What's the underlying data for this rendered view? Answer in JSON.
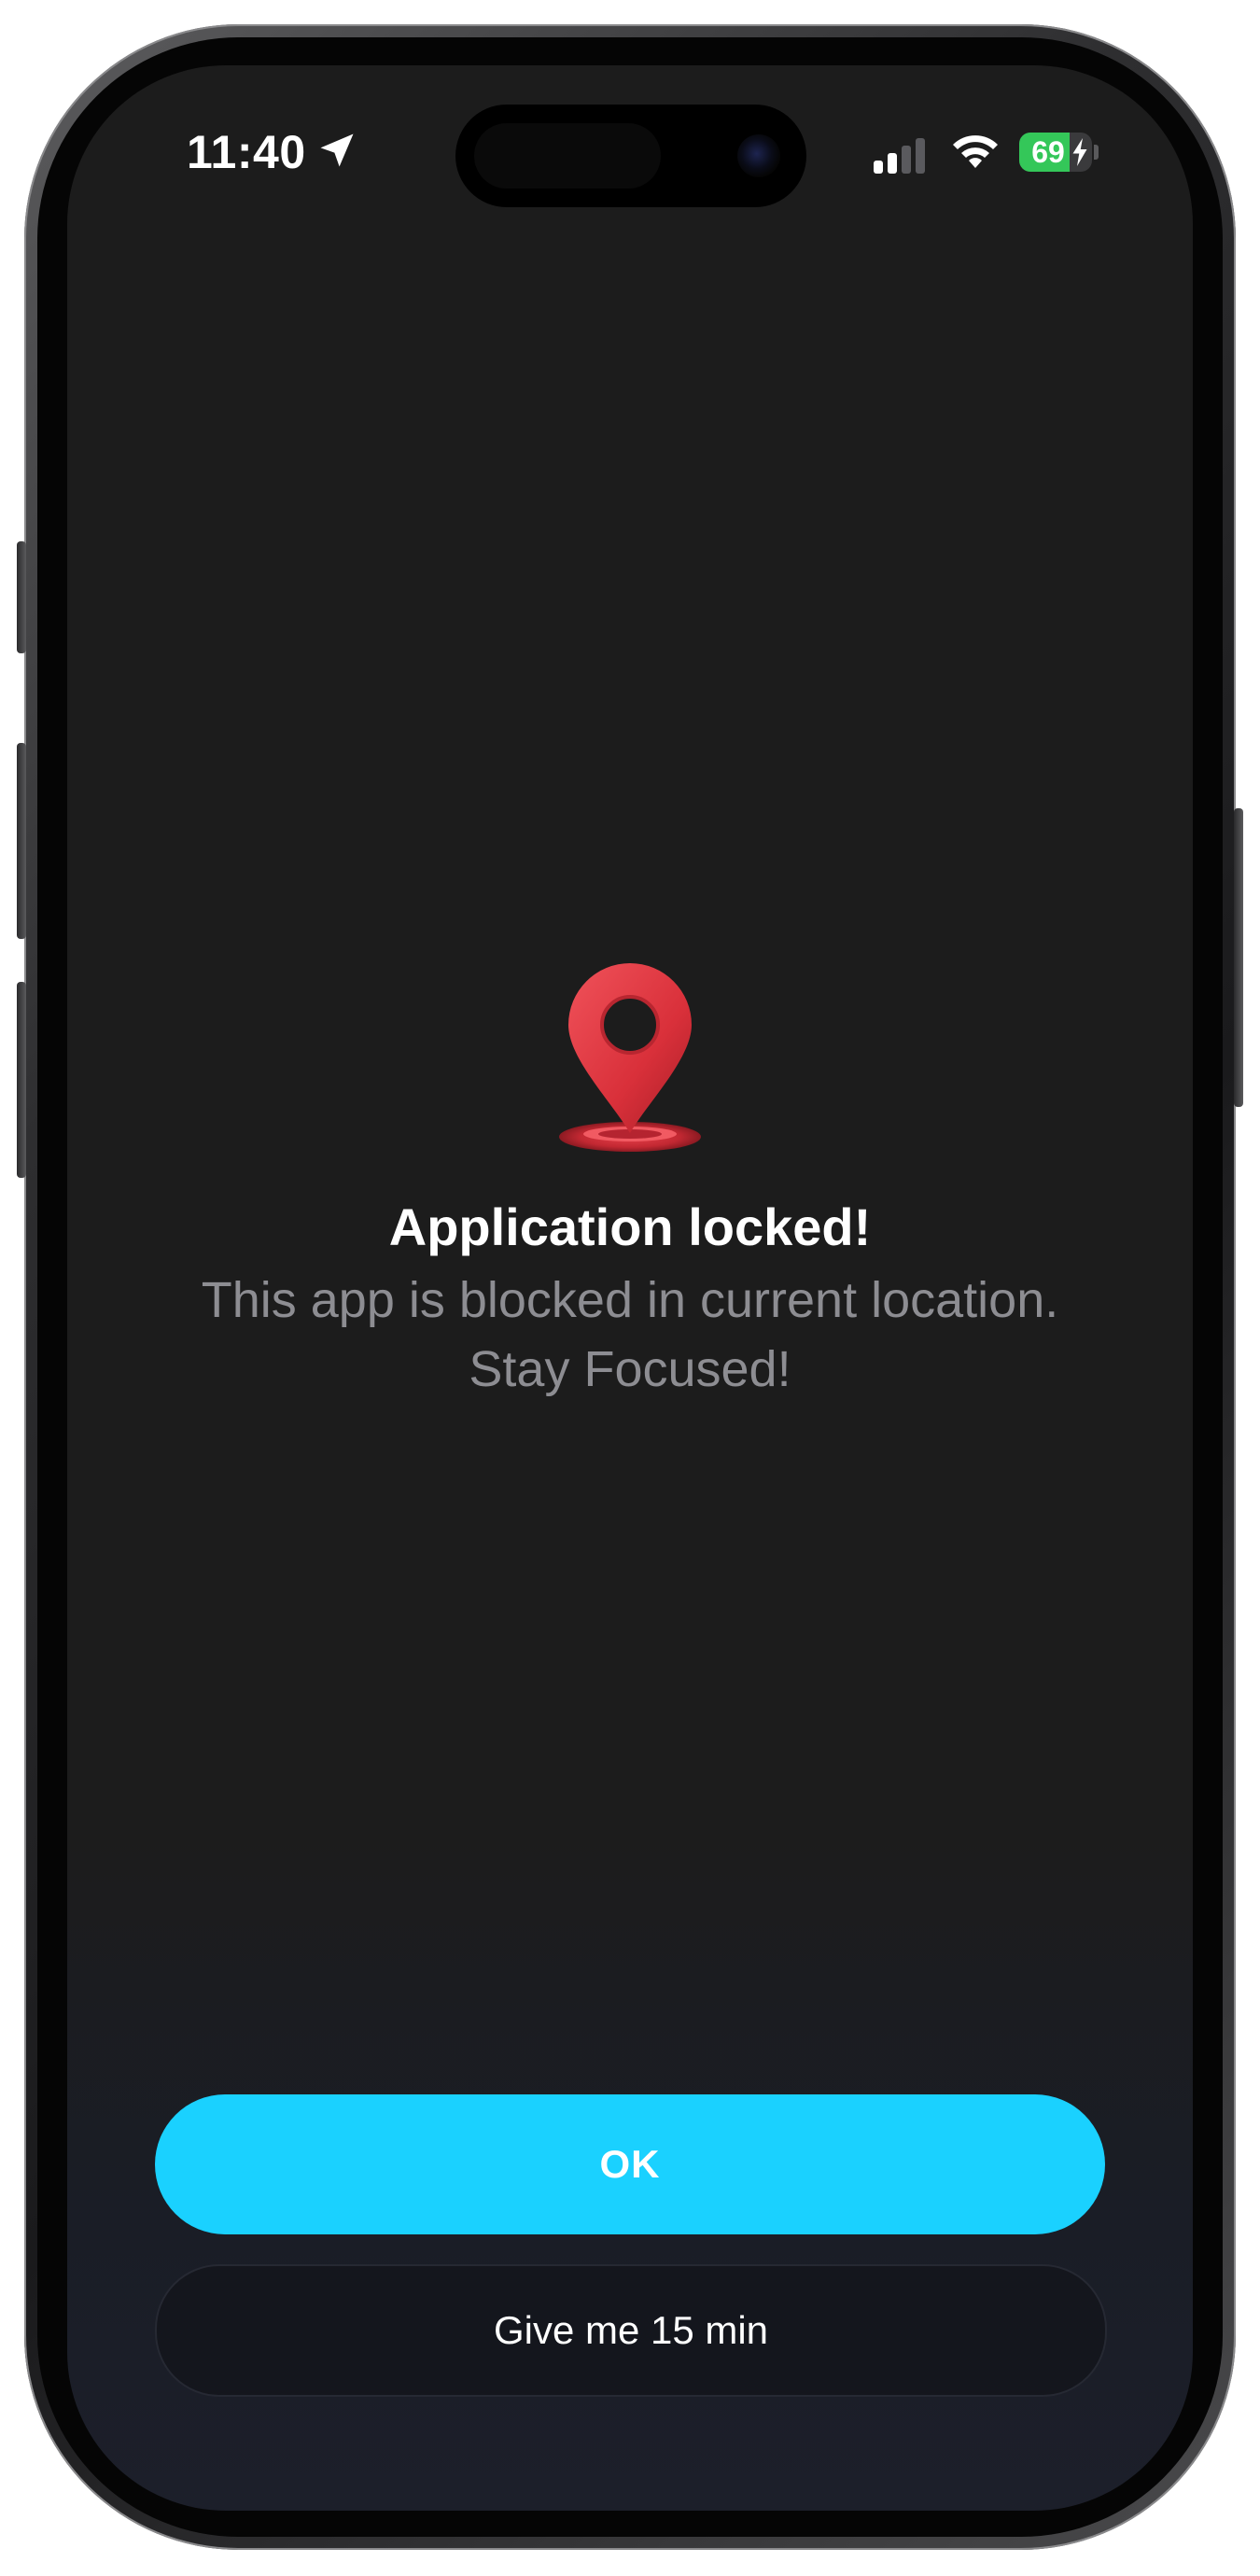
{
  "status_bar": {
    "time": "11:40",
    "battery_level": "69",
    "battery_charging": true,
    "location_active": true,
    "signal_bars_active": 2,
    "signal_bars_total": 4,
    "icons": [
      "location-arrow-icon",
      "cellular-signal-icon",
      "wifi-icon",
      "battery-icon",
      "charging-bolt-icon"
    ]
  },
  "lock_screen": {
    "icon": "map-pin-icon",
    "title": "Application locked!",
    "message_line1": "This app is blocked in current location.",
    "message_line2": "Stay Focused!"
  },
  "actions": {
    "ok_label": "OK",
    "later_label": "Give me 15 min"
  },
  "colors": {
    "background": "#1c1c1c",
    "accent": "#1ad1ff",
    "pin": "#e0343c",
    "battery": "#34c759",
    "secondary_text": "#8d8d92"
  }
}
